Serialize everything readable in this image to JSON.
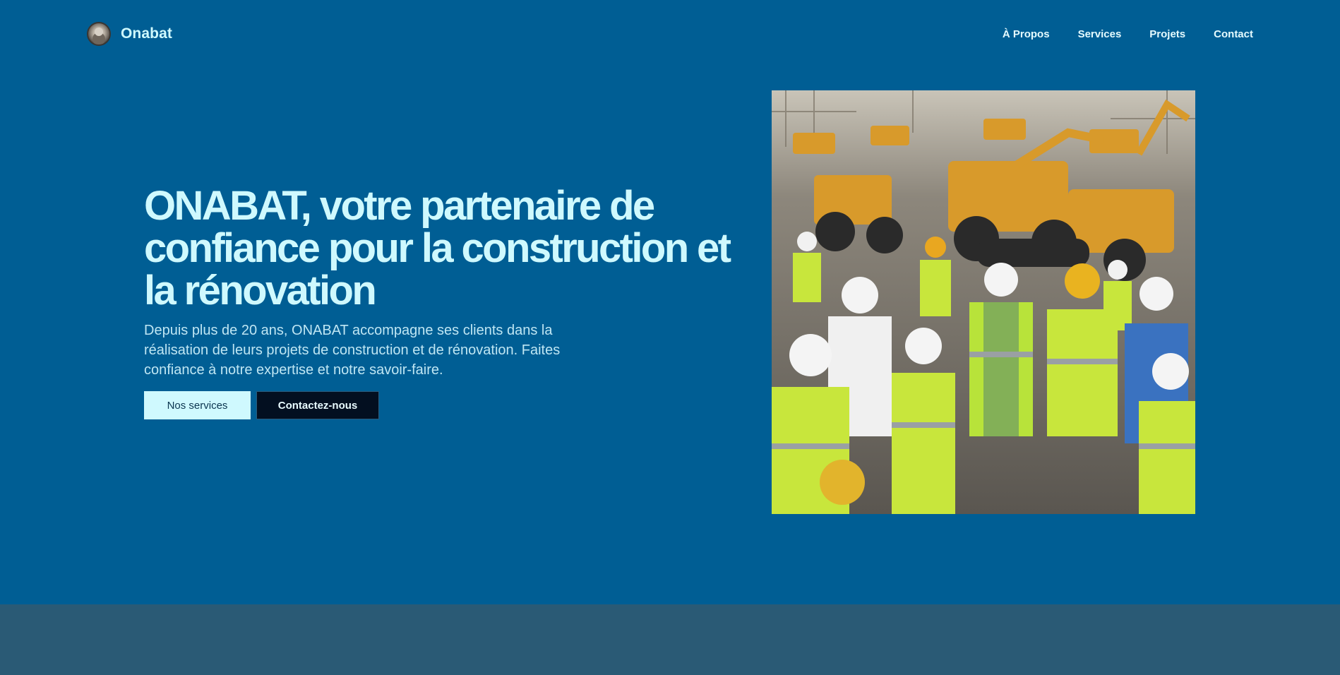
{
  "nav": {
    "brand": "Onabat",
    "links": [
      "À Propos",
      "Services",
      "Projets",
      "Contact"
    ]
  },
  "hero": {
    "title": "ONABAT, votre partenaire de confiance pour la construction et la rénovation",
    "subtitle": "Depuis plus de 20 ans, ONABAT accompagne ses clients dans la réalisation de leurs projets de construction et de rénovation. Faites confiance à notre expertise et notre savoir-faire.",
    "primary_button": "Nos services",
    "secondary_button": "Contactez-nous"
  },
  "colors": {
    "background": "#005e94",
    "accent": "#cff9fe",
    "dark_button": "#030f20",
    "footer_band": "#2a5a75"
  }
}
